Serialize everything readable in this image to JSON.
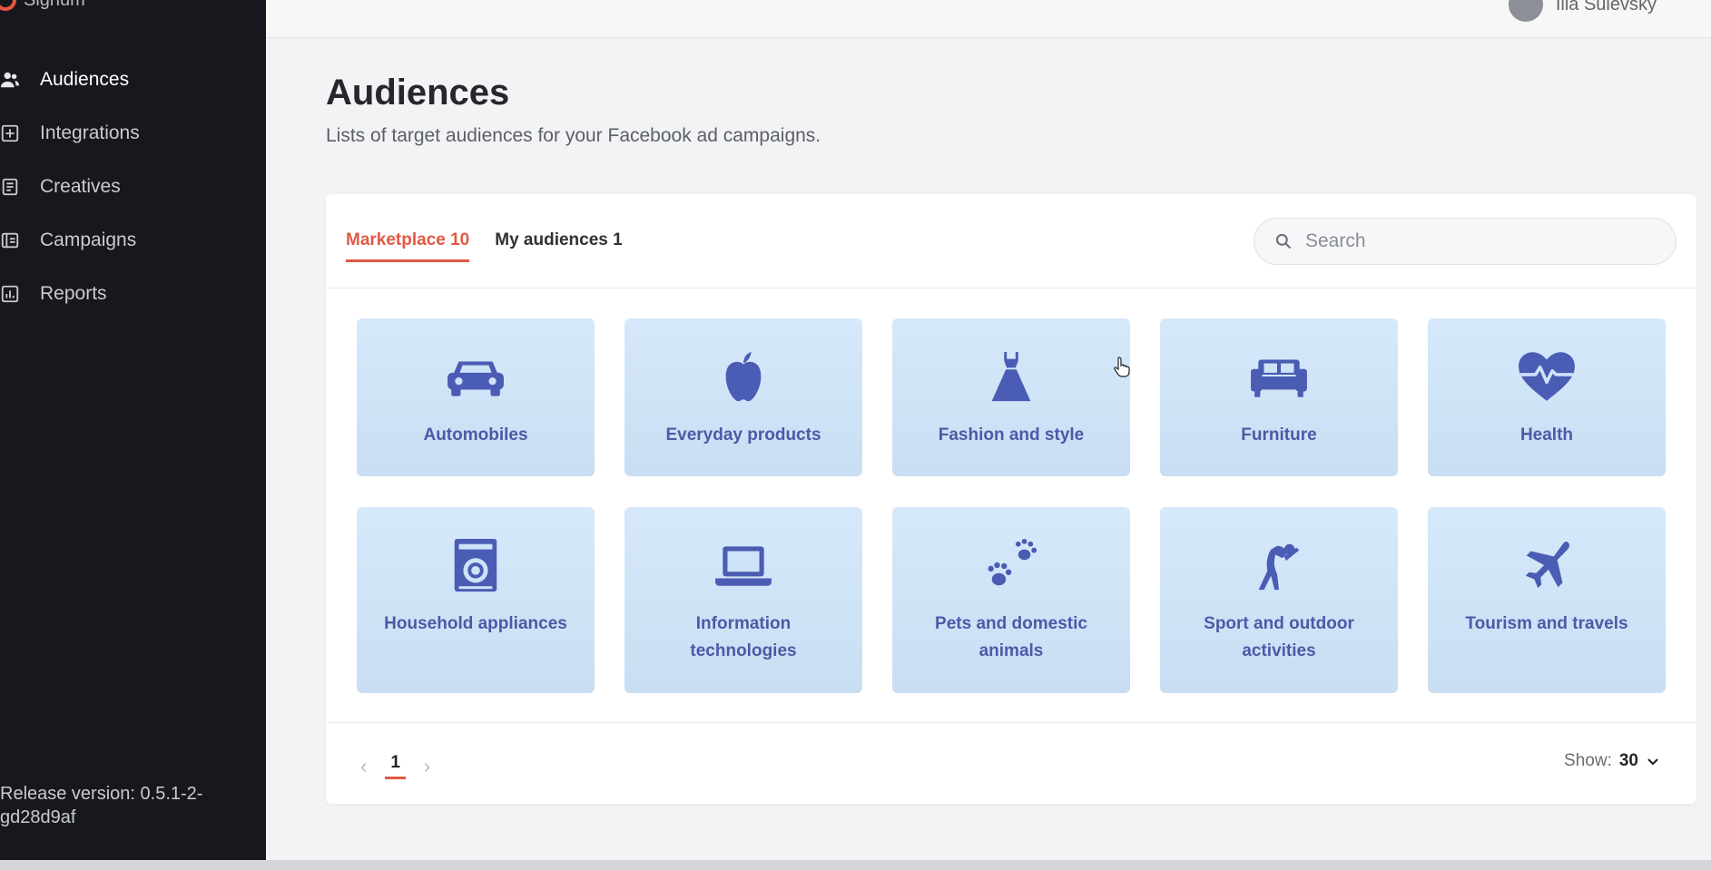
{
  "app": {
    "name": "Signum"
  },
  "sidebar": {
    "items": [
      {
        "label": "Audiences",
        "icon": "users-icon",
        "active": true
      },
      {
        "label": "Integrations",
        "icon": "plus-square-icon"
      },
      {
        "label": "Creatives",
        "icon": "document-icon"
      },
      {
        "label": "Campaigns",
        "icon": "media-icon"
      },
      {
        "label": "Reports",
        "icon": "bar-chart-icon"
      }
    ],
    "release": "Release version: 0.5.1-2-gd28d9af"
  },
  "user": {
    "name": "Ilia Sulevsky"
  },
  "page": {
    "title": "Audiences",
    "subtitle": "Lists of target audiences for your Facebook ad campaigns."
  },
  "tabs": [
    {
      "label": "Marketplace 10",
      "active": true
    },
    {
      "label": "My audiences 1"
    }
  ],
  "search": {
    "placeholder": "Search",
    "value": ""
  },
  "tiles": [
    {
      "label": "Automobiles",
      "icon": "car-icon"
    },
    {
      "label": "Everyday products",
      "icon": "apple-icon"
    },
    {
      "label": "Fashion and style",
      "icon": "dress-icon"
    },
    {
      "label": "Furniture",
      "icon": "sofa-icon"
    },
    {
      "label": "Health",
      "icon": "heart-pulse-icon"
    },
    {
      "label": "Household appliances",
      "icon": "washing-machine-icon"
    },
    {
      "label": "Information technologies",
      "icon": "laptop-icon"
    },
    {
      "label": "Pets and domestic animals",
      "icon": "paw-icon"
    },
    {
      "label": "Sport and outdoor activities",
      "icon": "stretching-person-icon"
    },
    {
      "label": "Tourism and travels",
      "icon": "airplane-icon"
    }
  ],
  "pagination": {
    "current": "1"
  },
  "show": {
    "label": "Show:",
    "value": "30"
  },
  "colors": {
    "accent": "#e05a45",
    "tile": "#d6e9fb",
    "icon": "#4a5cb4",
    "sidebar": "#16181d"
  }
}
